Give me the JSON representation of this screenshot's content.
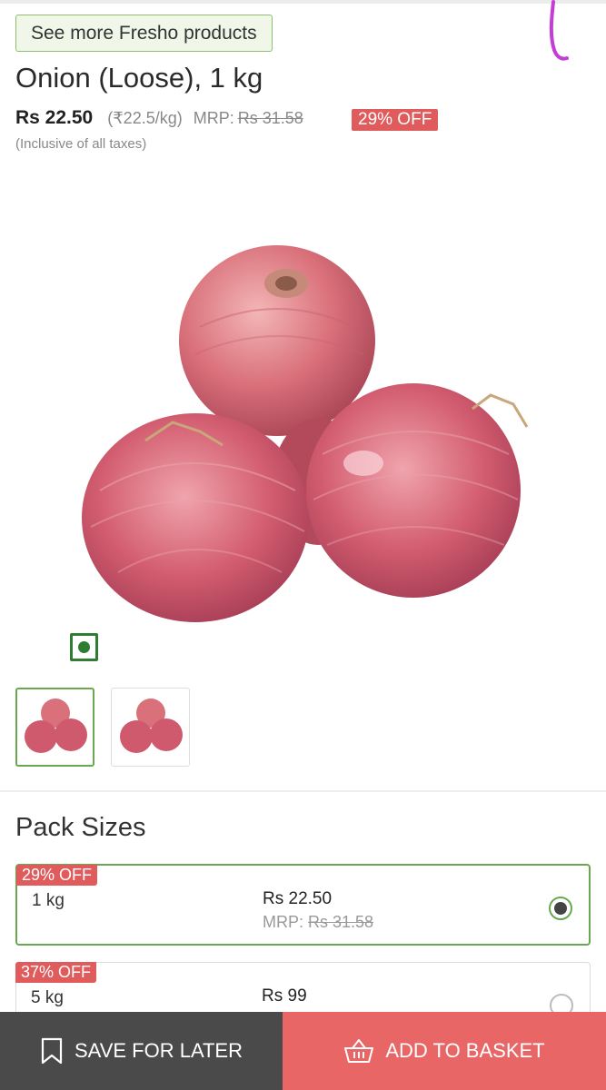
{
  "header": {
    "see_more_label": "See more Fresho products"
  },
  "product": {
    "title": "Onion (Loose), 1 kg",
    "price": "Rs 22.50",
    "per_unit": "(₹22.5/kg)",
    "mrp_label": "MRP:",
    "mrp_value": "Rs 31.58",
    "discount_badge": "29% OFF",
    "tax_note": "(Inclusive of all taxes)",
    "veg_indicator_icon": "veg-mark-icon",
    "image_icon": "onion-image",
    "thumbnails": [
      {
        "icon": "onion-thumbnail",
        "selected": true
      },
      {
        "icon": "onion-thumbnail",
        "selected": false
      }
    ]
  },
  "pack_sizes": {
    "title": "Pack Sizes",
    "items": [
      {
        "badge": "29% OFF",
        "size": "1 kg",
        "price": "Rs 22.50",
        "mrp_label": "MRP:",
        "mrp_value": "Rs 31.58",
        "selected": true
      },
      {
        "badge": "37% OFF",
        "size": "5 kg",
        "price": "Rs 99",
        "selected": false
      }
    ]
  },
  "actions": {
    "save_label": "SAVE FOR LATER",
    "save_icon": "bookmark-icon",
    "add_label": "ADD TO BASKET",
    "add_icon": "basket-icon"
  },
  "colors": {
    "accent_green": "#6aa84f",
    "discount_red": "#e05c5c",
    "add_button": "#e86666",
    "save_button": "#4a4a4a"
  }
}
